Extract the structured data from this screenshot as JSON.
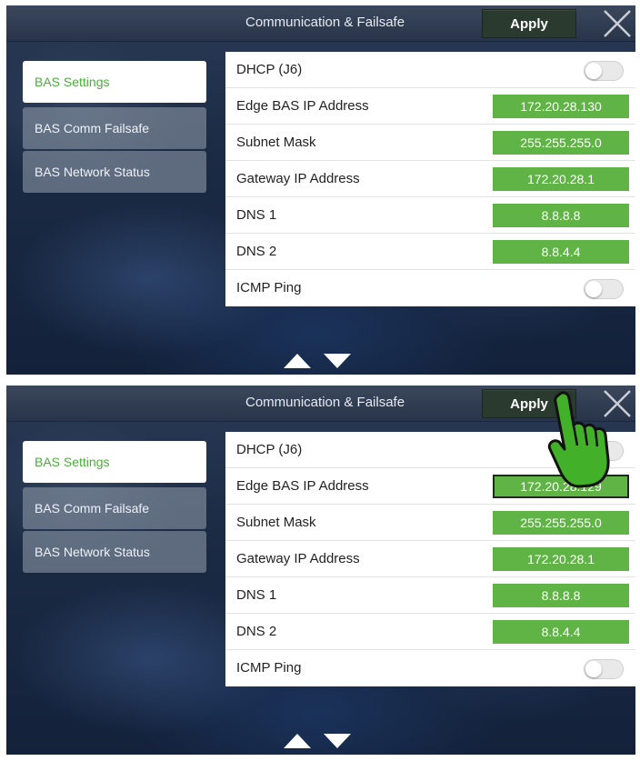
{
  "header": {
    "title": "Communication & Failsafe",
    "apply_label": "Apply"
  },
  "sidebar": {
    "items": [
      {
        "label": "BAS Settings",
        "active": true
      },
      {
        "label": "BAS Comm Failsafe",
        "active": false
      },
      {
        "label": "BAS Network Status",
        "active": false
      }
    ]
  },
  "screens": [
    {
      "rows": [
        {
          "label": "DHCP (J6)",
          "type": "toggle",
          "on": false
        },
        {
          "label": "Edge BAS IP Address",
          "type": "value",
          "value": "172.20.28.130"
        },
        {
          "label": "Subnet Mask",
          "type": "value",
          "value": "255.255.255.0"
        },
        {
          "label": "Gateway IP Address",
          "type": "value",
          "value": "172.20.28.1"
        },
        {
          "label": "DNS 1",
          "type": "value",
          "value": "8.8.8.8"
        },
        {
          "label": "DNS 2",
          "type": "value",
          "value": "8.8.4.4"
        },
        {
          "label": "ICMP Ping",
          "type": "toggle",
          "on": false
        }
      ]
    },
    {
      "rows": [
        {
          "label": "DHCP (J6)",
          "type": "toggle",
          "on": false
        },
        {
          "label": "Edge BAS IP Address",
          "type": "value",
          "value": "172.20.28.129",
          "editing": true
        },
        {
          "label": "Subnet Mask",
          "type": "value",
          "value": "255.255.255.0"
        },
        {
          "label": "Gateway IP Address",
          "type": "value",
          "value": "172.20.28.1"
        },
        {
          "label": "DNS 1",
          "type": "value",
          "value": "8.8.8.8"
        },
        {
          "label": "DNS 2",
          "type": "value",
          "value": "8.8.4.4"
        },
        {
          "label": "ICMP Ping",
          "type": "toggle",
          "on": false
        }
      ]
    }
  ],
  "icons": {
    "close": "close-icon",
    "scroll_up": "arrow-up-icon",
    "scroll_down": "arrow-down-icon",
    "pointer": "pointing-hand-icon"
  },
  "colors": {
    "accent_green": "#5fb445",
    "active_text_green": "#4bae3c"
  }
}
